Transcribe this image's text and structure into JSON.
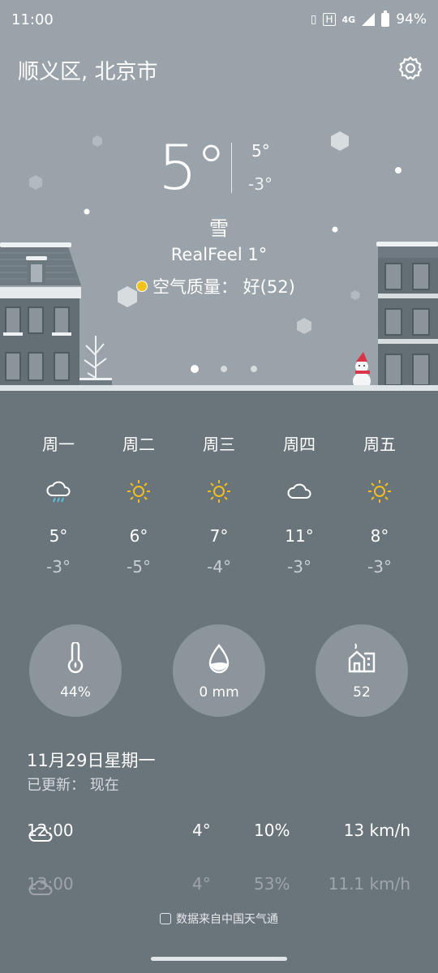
{
  "status": {
    "time": "11:00",
    "network": "4G",
    "battery": "94%"
  },
  "header": {
    "location": "顺义区, 北京市"
  },
  "current": {
    "temp": "5°",
    "high": "5°",
    "low": "-3°",
    "condition": "雪",
    "realfeel": "RealFeel 1°",
    "aqi": "空气质量：  好(52)"
  },
  "pager": {
    "pages": 3,
    "active": 1
  },
  "forecast": [
    {
      "day": "周一",
      "icon": "rain-cloud-icon",
      "high": "5°",
      "low": "-3°"
    },
    {
      "day": "周二",
      "icon": "sun-icon",
      "high": "6°",
      "low": "-5°"
    },
    {
      "day": "周三",
      "icon": "sun-icon",
      "high": "7°",
      "low": "-4°"
    },
    {
      "day": "周四",
      "icon": "cloud-icon",
      "high": "11°",
      "low": "-3°"
    },
    {
      "day": "周五",
      "icon": "sun-icon",
      "high": "8°",
      "low": "-3°"
    }
  ],
  "stats": {
    "humidity": "44%",
    "precipitation": "0 mm",
    "air_quality": "52"
  },
  "today": {
    "date": "11月29日星期一",
    "updated": "已更新：  现在"
  },
  "hourly": [
    {
      "time": "12:00",
      "icon": "cloud-icon",
      "temp": "4°",
      "precip": "10%",
      "wind": "13 km/h"
    },
    {
      "time": "13:00",
      "icon": "cloud-icon",
      "temp": "4°",
      "precip": "53%",
      "wind": "11.1 km/h"
    }
  ],
  "footer": {
    "source": "数据来自中国天气通"
  },
  "colors": {
    "sun": "#f2bd1d",
    "rain": "#5bc0de",
    "aqi_good": "#f1c21b"
  }
}
